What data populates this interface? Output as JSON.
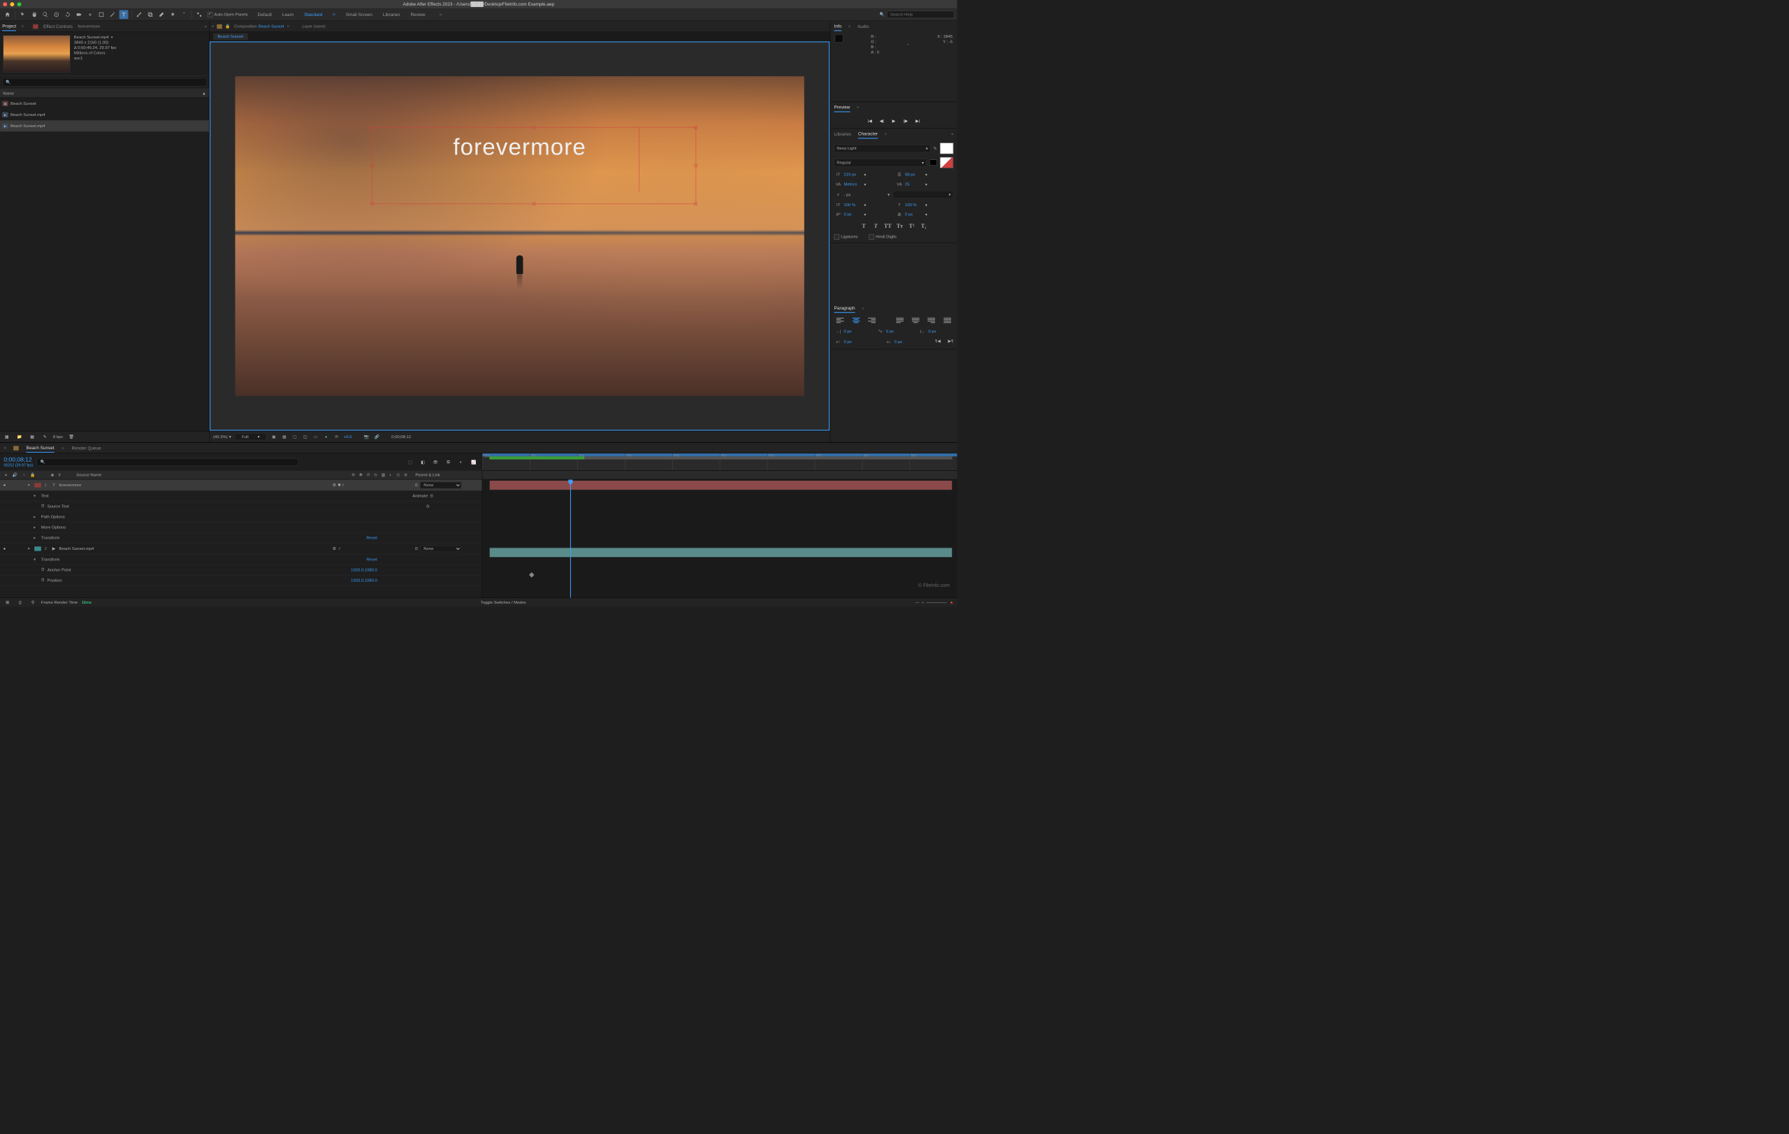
{
  "titlebar": {
    "text": "Adobe After Effects 2023 - /Users/████/Desktop/FileInfo.com Example.aep"
  },
  "toolbar": {
    "auto_open": "Auto-Open Panels",
    "workspaces": [
      "Default",
      "Learn",
      "Standard",
      "Small Screen",
      "Libraries",
      "Review"
    ],
    "search_ph": "Search Help"
  },
  "project": {
    "tab_project": "Project",
    "tab_effects": "Effect Controls",
    "effects_name": "forevermore",
    "name": "Beach Sunset.mp4",
    "dims": "3840 x 2160 (1.00)",
    "dur": "Δ 0;00;46;24, 29.97 fps",
    "colors": "Millions of Colors",
    "codec": "avc1",
    "col_name": "Name",
    "items": [
      "Beach Sunset",
      "Beach Sunset.mp4",
      "Beach Sunset.mp4"
    ],
    "bpc": "8 bpc"
  },
  "comp": {
    "tab_label": "Composition",
    "name": "Beach Sunset",
    "layer_label": "Layer (none)",
    "subtab": "Beach Sunset",
    "overlay_text": "forevermore",
    "zoom": "(49.3%)",
    "res": "Full",
    "exposure": "+0.0",
    "timecode": "0;00;08;12"
  },
  "info": {
    "tab_info": "Info",
    "tab_audio": "Audio",
    "r": "R :",
    "g": "G :",
    "b": "B :",
    "a": "A :",
    "a_val": "0",
    "x": "X :",
    "x_val": "2845",
    "y": "Y :",
    "y_val": "-5"
  },
  "preview": {
    "label": "Preview"
  },
  "char": {
    "tab_lib": "Libraries",
    "tab_char": "Character",
    "font": "Nexa Light",
    "weight": "Regular",
    "size": "219 px",
    "leading": "58 px",
    "kerning": "Metrics",
    "tracking": "25",
    "stroke": "- px",
    "vscale": "100 %",
    "hscale": "100 %",
    "baseline": "0 px",
    "tsume": "0 px",
    "ligatures": "Ligatures",
    "hindi": "Hindi Digits"
  },
  "para": {
    "label": "Paragraph",
    "indent_l": "0 px",
    "indent_r": "0 px",
    "indent_f": "0 px",
    "space_b": "0 px",
    "space_a": "0 px"
  },
  "timeline": {
    "tab_comp": "Beach Sunset",
    "tab_rq": "Render Queue",
    "timecode": "0;00;08;12",
    "frames": "00252 (29.97 fps)",
    "col_num": "#",
    "col_source": "Source Name",
    "col_parent": "Parent & Link",
    "marks": [
      ";00s",
      "05s",
      "10s",
      "15s",
      "20s",
      "25s",
      "30s",
      "35s",
      "40s",
      "45s"
    ],
    "layer1": {
      "num": "1",
      "name": "forevermore",
      "parent": "None"
    },
    "layer2": {
      "num": "2",
      "name": "Beach Sunset.mp4",
      "parent": "None"
    },
    "text_label": "Text",
    "animate": "Animate:",
    "source_text": "Source Text",
    "path_opts": "Path Options",
    "more_opts": "More Options",
    "transform": "Transform",
    "reset": "Reset",
    "anchor": "Anchor Point",
    "anchor_val": "1920.0,1080.0",
    "position": "Position",
    "position_val": "1920.0,1080.0",
    "frt_label": "Frame Render Time",
    "frt_val": "16ms",
    "toggle": "Toggle Switches / Modes"
  },
  "credit": "© FileInfo.com"
}
